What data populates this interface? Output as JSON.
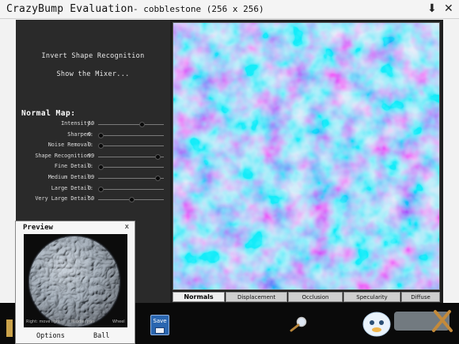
{
  "window": {
    "app_title": "CrazyBump Evaluation",
    "file_title": "- cobblestone (256 x 256)",
    "download_icon": "download-arrow-icon",
    "close_icon": "close-icon",
    "close_glyph": "✕",
    "download_glyph": "⬇"
  },
  "options": {
    "invert_label": "Invert Shape Recognition",
    "mixer_label": "Show the Mixer..."
  },
  "normal_map": {
    "title": "Normal Map:",
    "sliders": [
      {
        "label": "Intensity:",
        "value": "50",
        "fraction": 0.68
      },
      {
        "label": "Sharpen:",
        "value": "0",
        "fraction": 0.0
      },
      {
        "label": "Noise Removal:",
        "value": "0",
        "fraction": 0.0
      },
      {
        "label": "Shape Recognition:",
        "value": "99",
        "fraction": 0.93
      },
      {
        "label": "Fine Detail:",
        "value": "0",
        "fraction": 0.0
      },
      {
        "label": "Medium Detail:",
        "value": "99",
        "fraction": 0.93
      },
      {
        "label": "Large Detail:",
        "value": "0",
        "fraction": 0.0
      },
      {
        "label": "Very Large Detail:",
        "value": "50",
        "fraction": 0.5
      }
    ]
  },
  "tabs": [
    {
      "label": "Normals",
      "active": true
    },
    {
      "label": "Displacement",
      "active": false
    },
    {
      "label": "Occlusion",
      "active": false
    },
    {
      "label": "Specularity",
      "active": false
    },
    {
      "label": "Diffuse",
      "active": false
    }
  ],
  "preview": {
    "title": "Preview",
    "close": "x",
    "hint_left": "Right: move light",
    "hint_mid": "Middle: pan",
    "hint_right": "Wheel",
    "options_button": "Options",
    "ball_button": "Ball"
  },
  "toolbar": {
    "save_label": "Save",
    "magnifier_icon": "magnifier-icon",
    "save_icon": "floppy-disk-icon"
  },
  "colors": {
    "normal_base": "#8a84f4",
    "normal_cyan": "#55e6ee",
    "normal_magenta": "#e45ad6",
    "panel": "#2a2a2a"
  }
}
